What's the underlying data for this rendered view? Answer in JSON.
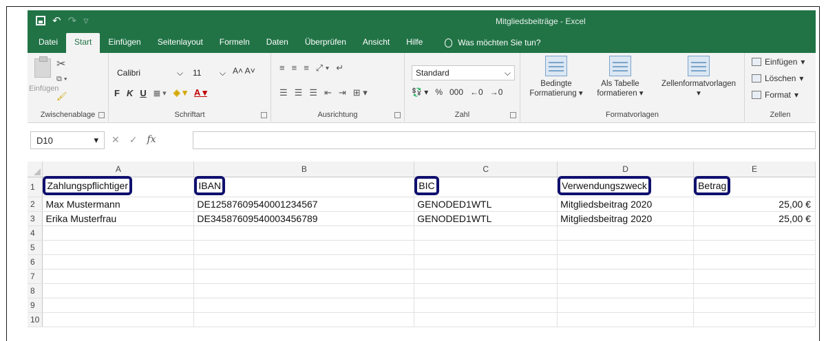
{
  "window": {
    "title": "Mitgliedsbeiträge - Excel"
  },
  "qat": {
    "undo": "↶",
    "redo": "↷",
    "more": "▿"
  },
  "tabs": [
    "Datei",
    "Start",
    "Einfügen",
    "Seitenlayout",
    "Formeln",
    "Daten",
    "Überprüfen",
    "Ansicht",
    "Hilfe"
  ],
  "tell_me": "Was möchten Sie tun?",
  "ribbon": {
    "clipboard": {
      "label": "Zwischenablage",
      "paste": "Einfügen"
    },
    "font": {
      "label": "Schriftart",
      "name": "Calibri",
      "size": "11",
      "bold": "F",
      "italic": "K",
      "underline": "U"
    },
    "alignment": {
      "label": "Ausrichtung"
    },
    "number": {
      "label": "Zahl",
      "format": "Standard",
      "percent": "%",
      "thousands": "000"
    },
    "styles": {
      "label": "Formatvorlagen",
      "conditional": [
        "Bedingte",
        "Formatierung ▾"
      ],
      "table": [
        "Als Tabelle",
        "formatieren ▾"
      ],
      "cell": [
        "Zellenformatvorlagen",
        "▾"
      ]
    },
    "cells": {
      "label": "Zellen",
      "insert": "Einfügen",
      "delete": "Löschen",
      "format": "Format"
    }
  },
  "formula_bar": {
    "name_box": "D10",
    "fx": "fx",
    "value": ""
  },
  "columns": [
    "A",
    "B",
    "C",
    "D",
    "E"
  ],
  "rows": [
    [
      "Zahlungspflichtiger",
      "IBAN",
      "BIC",
      "Verwendungszweck",
      "Betrag"
    ],
    [
      "Max Mustermann",
      "DE12587609540001234567",
      "GENODED1WTL",
      "Mitgliedsbeitrag 2020",
      "25,00 €"
    ],
    [
      "Erika Musterfrau",
      "DE34587609540003456789",
      "GENODED1WTL",
      "Mitgliedsbeitrag 2020",
      "25,00 €"
    ],
    [
      "",
      "",
      "",
      "",
      ""
    ],
    [
      "",
      "",
      "",
      "",
      ""
    ],
    [
      "",
      "",
      "",
      "",
      ""
    ],
    [
      "",
      "",
      "",
      "",
      ""
    ],
    [
      "",
      "",
      "",
      "",
      ""
    ],
    [
      "",
      "",
      "",
      "",
      ""
    ],
    [
      "",
      "",
      "",
      "",
      ""
    ]
  ],
  "colors": {
    "accent": "#217346",
    "highlight": "#10106e"
  }
}
